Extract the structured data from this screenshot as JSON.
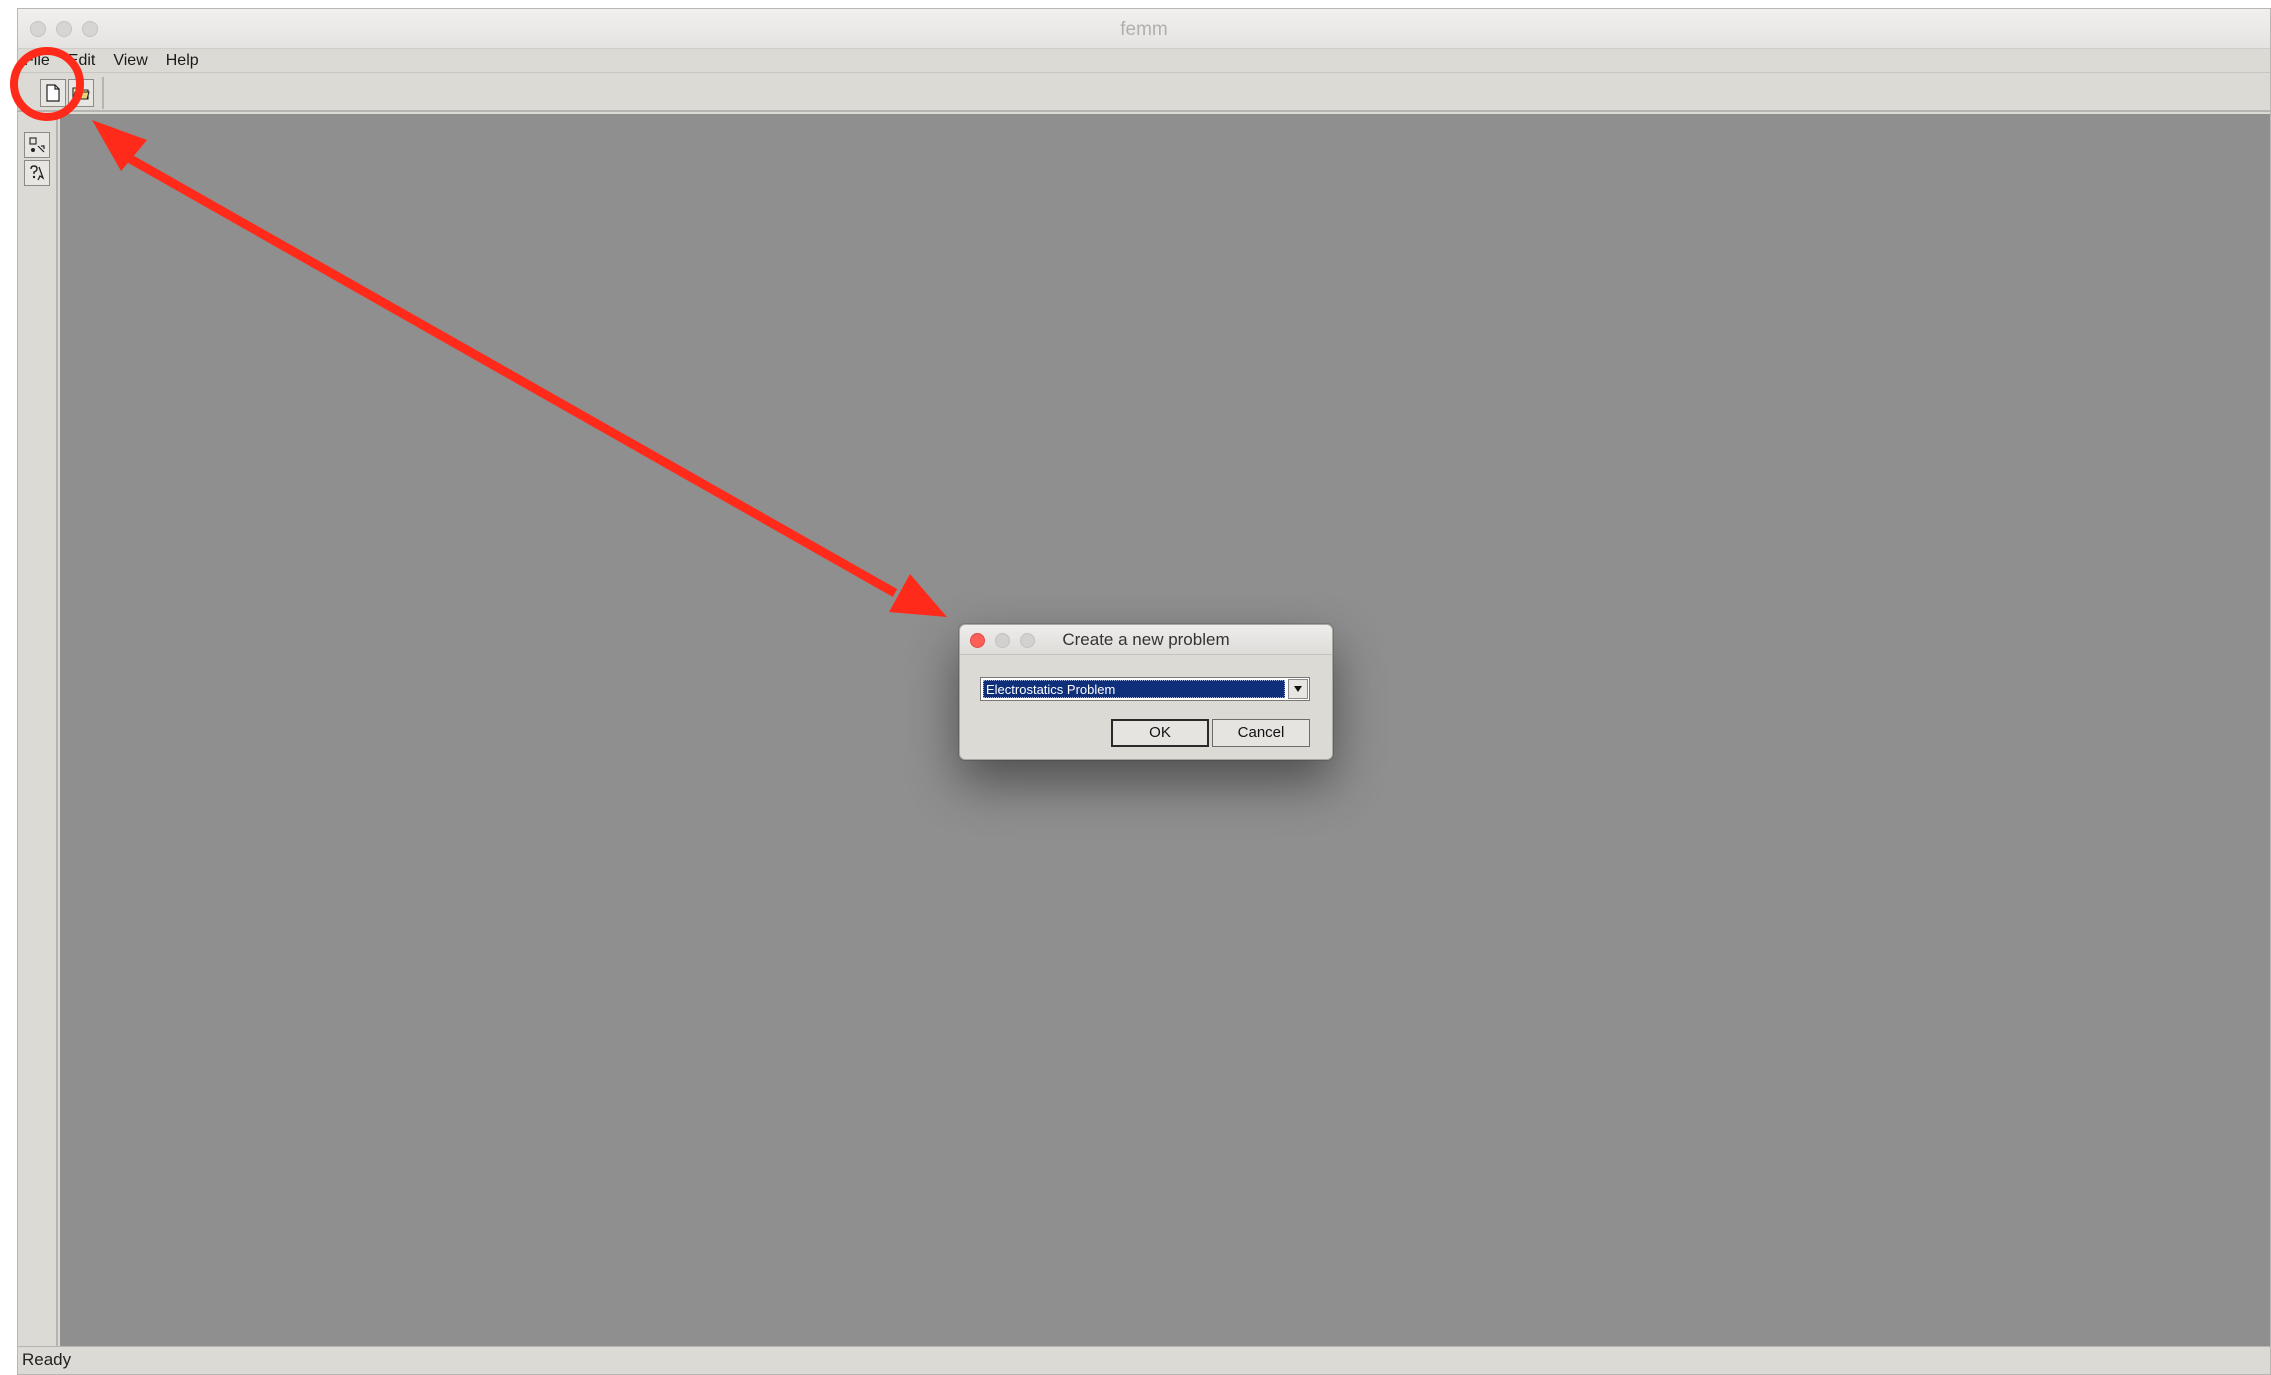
{
  "window": {
    "title": "femm"
  },
  "menubar": {
    "items": [
      {
        "label": "File"
      },
      {
        "label": "Edit"
      },
      {
        "label": "View"
      },
      {
        "label": "Help"
      }
    ]
  },
  "toolbar": {
    "buttons": [
      {
        "icon": "new-document-icon",
        "label": "New"
      },
      {
        "icon": "open-folder-icon",
        "label": "Open"
      }
    ]
  },
  "left_toolbar": {
    "buttons": [
      {
        "icon": "tool-icon"
      },
      {
        "icon": "help-icon"
      }
    ]
  },
  "dialog": {
    "title": "Create a new problem",
    "select": {
      "value": "Electrostatics Problem"
    },
    "ok_label": "OK",
    "cancel_label": "Cancel"
  },
  "status": {
    "text": "Ready"
  },
  "annotation": {
    "color": "#ff2a1a"
  }
}
